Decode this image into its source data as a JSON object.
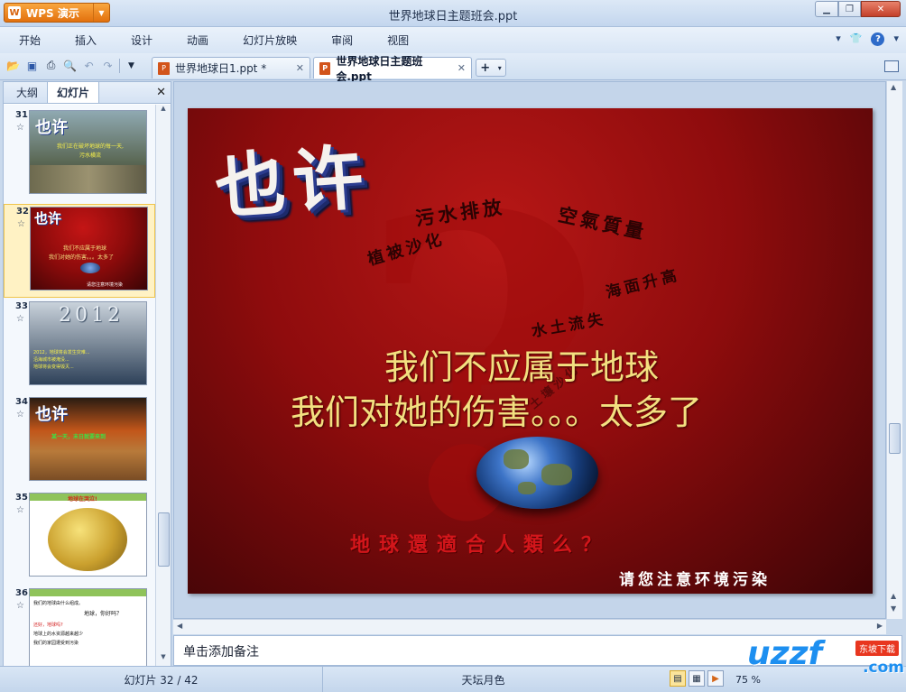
{
  "app": {
    "menu_label": "WPS 演示",
    "window_title": "世界地球日主题班会.ppt"
  },
  "menu": [
    "开始",
    "插入",
    "设计",
    "动画",
    "幻灯片放映",
    "审阅",
    "视图"
  ],
  "doc_tabs": [
    {
      "label": "世界地球日1.ppt *",
      "active": false
    },
    {
      "label": "世界地球日主题班会.ppt",
      "active": true
    }
  ],
  "panel": {
    "tabs": [
      "大纲",
      "幻灯片"
    ],
    "active_tab": "幻灯片",
    "slides": [
      {
        "num": "31",
        "title": "也许",
        "lines": [
          "我们正在破坏地球的每一天,",
          "污水横流"
        ]
      },
      {
        "num": "32",
        "title": "也许",
        "lines": [
          "我们不应属于地球",
          "我们对她的伤害。。。太多了"
        ],
        "footer": "请您注意环境污染"
      },
      {
        "num": "33",
        "title": "2012",
        "lines": [
          "2012，地球将会发生灾难...",
          "沿海城市被淹没...",
          "地球将会变得毁灭..."
        ]
      },
      {
        "num": "34",
        "title": "也许",
        "lines": [
          "某一天，末日就要来到"
        ]
      },
      {
        "num": "35",
        "title": "地球在哭泣!",
        "lines": []
      },
      {
        "num": "36",
        "title": "",
        "lines": [
          "我们的地球由什么组成。",
          "地球，你好吗？",
          "还好，地球吗?",
          "地球上的水资源越来越少",
          "我们的家园遭受到污染"
        ]
      }
    ]
  },
  "slide": {
    "title_art": "也许",
    "ribbon_words": [
      "污水排放",
      "空氣質量",
      "植被沙化",
      "海面升高",
      "水土流失",
      "土壤沙化"
    ],
    "main_lines": [
      "我们不应属于地球",
      "我们对她的伤害。。。太多了"
    ],
    "question": "地球還適合人類么？",
    "signature": "请您注意环境污染"
  },
  "notes_placeholder": "单击添加备注",
  "status": {
    "slide_counter": "幻灯片 32 / 42",
    "theme": "天坛月色",
    "zoom": "75 %"
  },
  "watermark": {
    "logo": "uzzf",
    "badge": "东坡下载",
    "suffix": ".com"
  }
}
